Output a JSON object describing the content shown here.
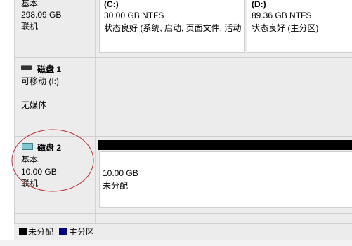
{
  "disk0": {
    "type": "基本",
    "size": "298.09 GB",
    "status": "联机",
    "partitions": [
      {
        "drive": "(C:)",
        "size_fs": "30.00 GB NTFS",
        "status": "状态良好 (系统, 启动, 页面文件, 活动"
      },
      {
        "drive": "(D:)",
        "size_fs": "89.36 GB NTFS",
        "status": "状态良好 (主分区)"
      }
    ]
  },
  "disk1": {
    "name": "磁盘 1",
    "type": "可移动 (I:)",
    "media": "无媒体"
  },
  "disk2": {
    "name": "磁盘 2",
    "type": "基本",
    "size": "10.00 GB",
    "status": "联机",
    "unallocated_size": "10.00 GB",
    "unallocated_label": "未分配"
  },
  "legend": [
    {
      "label": "未分配",
      "color": "#000000"
    },
    {
      "label": "主分区",
      "color": "#000080"
    }
  ]
}
